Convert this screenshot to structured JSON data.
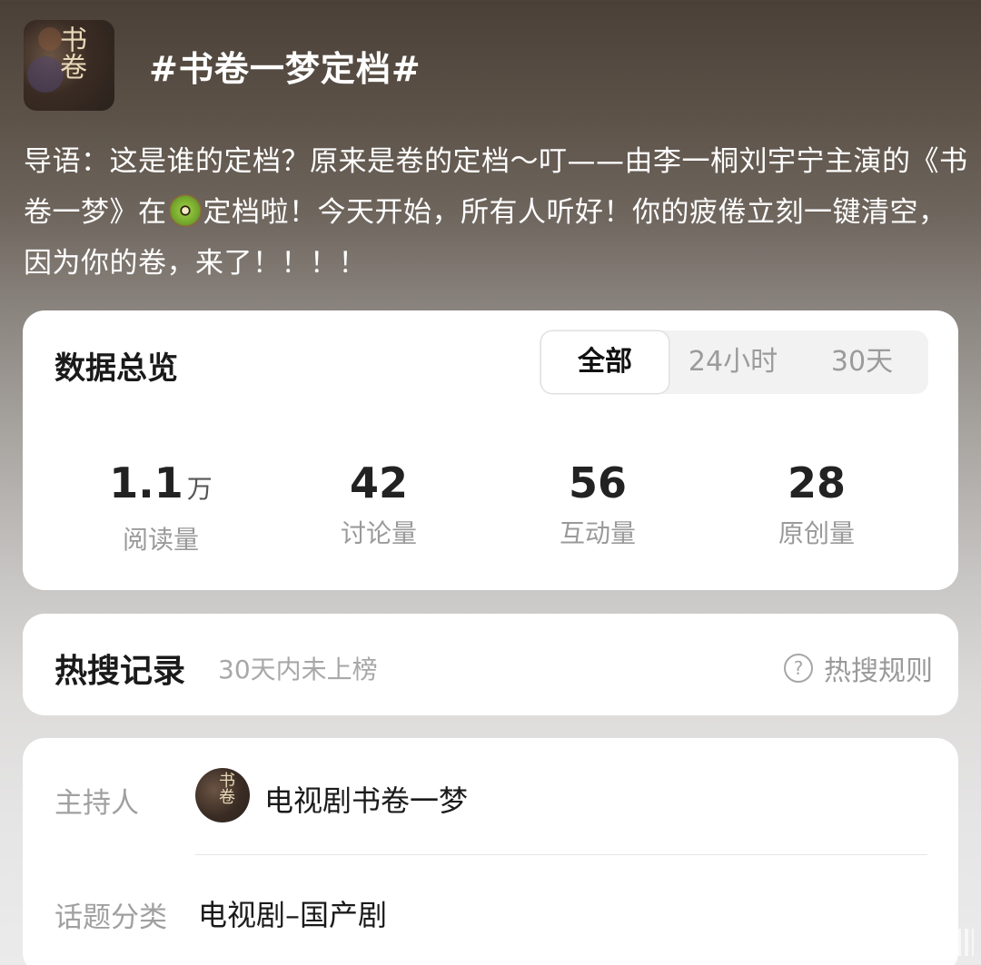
{
  "header": {
    "topic_title": "#书卷一梦定档#"
  },
  "intro": {
    "text_before_icon": "导语：这是谁的定档？原来是卷的定档～叮——由李一桐刘宇宁主演的《书卷一梦》在",
    "icon": "kiwi-icon",
    "text_after_icon": "定档啦！今天开始，所有人听好！你的疲倦立刻一键清空，因为你的卷，来了！！！！"
  },
  "overview": {
    "title": "数据总览",
    "tabs": [
      {
        "label": "全部",
        "active": true
      },
      {
        "label": "24小时",
        "active": false
      },
      {
        "label": "30天",
        "active": false
      }
    ],
    "stats": [
      {
        "value": "1.1",
        "unit": "万",
        "label": "阅读量"
      },
      {
        "value": "42",
        "unit": "",
        "label": "讨论量"
      },
      {
        "value": "56",
        "unit": "",
        "label": "互动量"
      },
      {
        "value": "28",
        "unit": "",
        "label": "原创量"
      }
    ]
  },
  "hot_search": {
    "title": "热搜记录",
    "status": "30天内未上榜",
    "rules_label": "热搜规则",
    "rules_icon": "question-icon"
  },
  "info": {
    "host_label": "主持人",
    "host_name": "电视剧书卷一梦",
    "category_label": "话题分类",
    "category_value": "电视剧–国产剧"
  }
}
